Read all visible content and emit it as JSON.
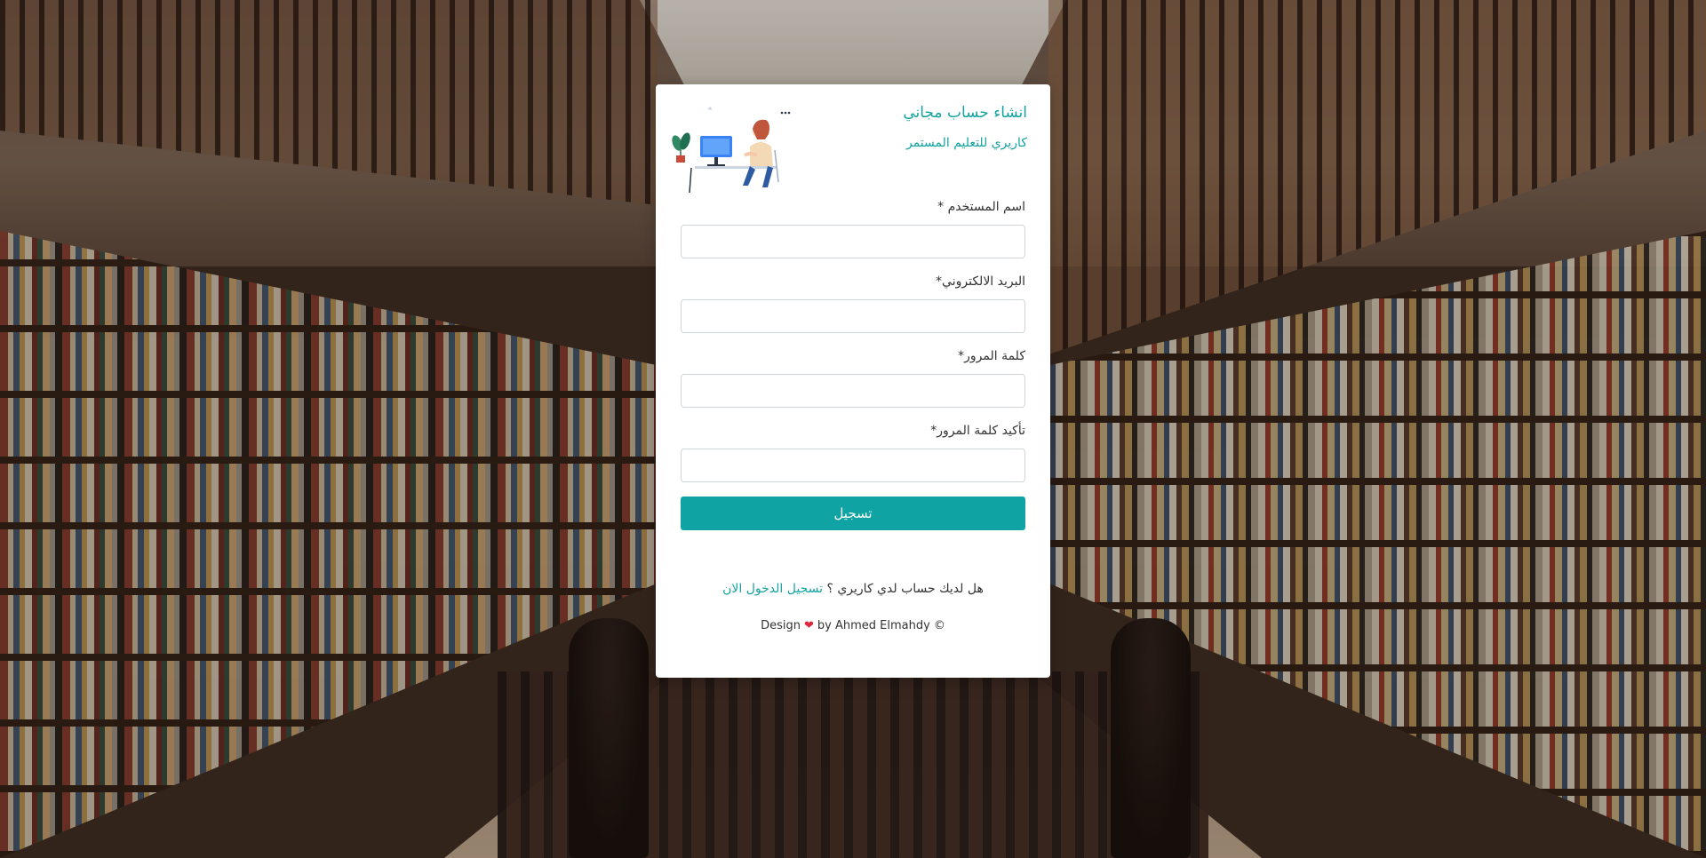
{
  "signup": {
    "title": "انشاء حساب مجاني",
    "subtitle": "كاريري للتعليم المستمر",
    "fields": [
      {
        "label": "اسم المستخدم *",
        "value": "",
        "placeholder": ""
      },
      {
        "label": "البريد الالكتروني*",
        "value": "",
        "placeholder": ""
      },
      {
        "label": "كلمة المرور*",
        "value": "",
        "placeholder": ""
      },
      {
        "label": "تأكيد كلمة المرور*",
        "value": "",
        "placeholder": ""
      }
    ],
    "submit_label": "تسجيل",
    "login_prompt": "هل لديك حساب لدي كاريري ؟",
    "login_link": "تسجيل الدخول الان"
  },
  "footer": {
    "design_text": "Design",
    "author_text": "by Ahmed Elmahdy ©"
  },
  "theme": {
    "accent": "#0fa3a3",
    "heart": "#e0253a"
  },
  "icons": {
    "heart": "heart-icon",
    "illustration": "person-at-computer-illustration"
  }
}
